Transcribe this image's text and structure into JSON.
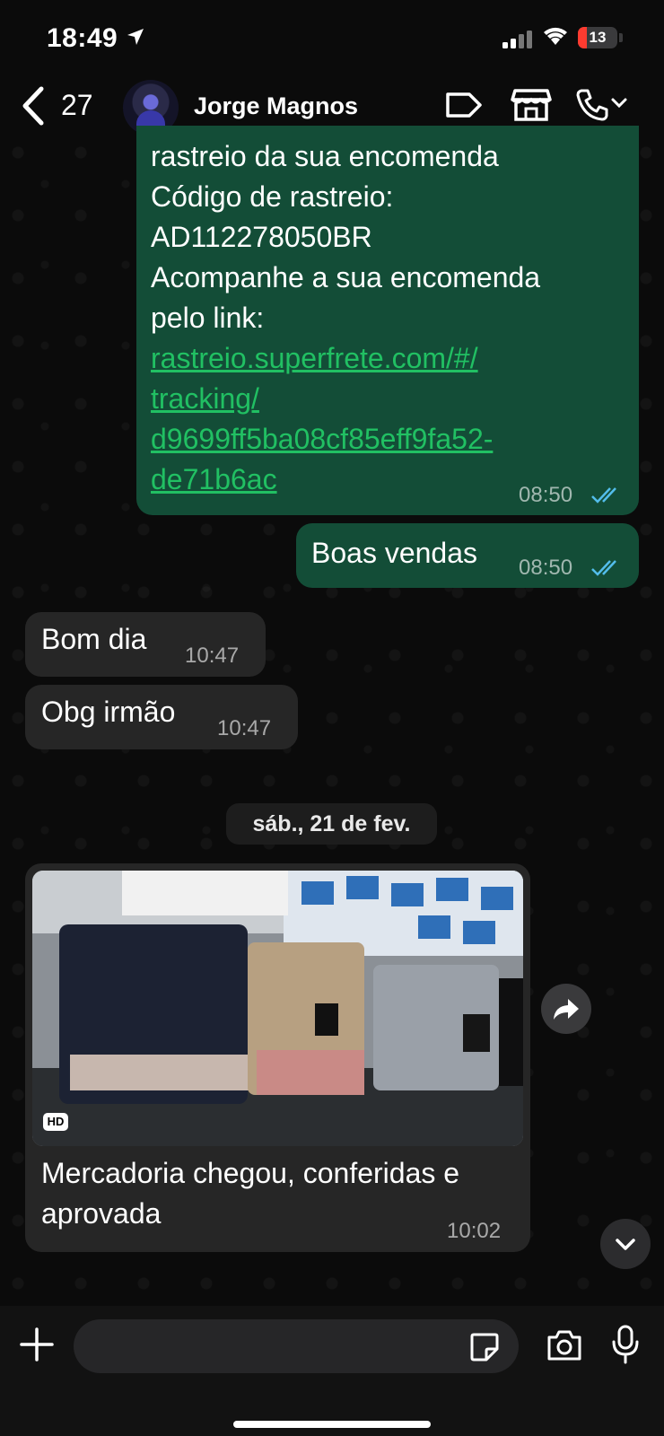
{
  "status_bar": {
    "time": "18:49",
    "battery": "13"
  },
  "header": {
    "unread_count": "27",
    "contact_name": "Jorge Magnos"
  },
  "messages": {
    "m1": {
      "lines": [
        "rastreio da sua encomenda",
        "Código de rastreio:",
        "AD112278050BR",
        "Acompanhe a sua encomenda",
        "pelo link:"
      ],
      "link_lines": [
        "rastreio.superfrete.com/#/",
        "tracking/",
        "d9699ff5ba08cf85eff9fa52-",
        "de71b6ac"
      ],
      "time": "08:50"
    },
    "m2": {
      "text": "Boas vendas",
      "time": "08:50"
    },
    "m3": {
      "text": "Bom dia",
      "time": "10:47"
    },
    "m4": {
      "text": "Obg irmão",
      "time": "10:47"
    },
    "date_chip": "sáb., 21 de fev.",
    "m5": {
      "hd_badge": "HD",
      "caption_line1": "Mercadoria chegou, conferidas e",
      "caption_line2": "aprovada",
      "time": "10:02"
    }
  },
  "colors": {
    "outgoing_bubble": "#134d37",
    "incoming_bubble": "#262626",
    "read_ticks": "#53bdeb",
    "link": "#21c063"
  },
  "icons": [
    "back-chevron-icon",
    "label-tag-icon",
    "store-icon",
    "phone-icon",
    "chevron-down-icon",
    "forward-icon",
    "plus-icon",
    "sticker-icon",
    "camera-icon",
    "mic-icon"
  ]
}
